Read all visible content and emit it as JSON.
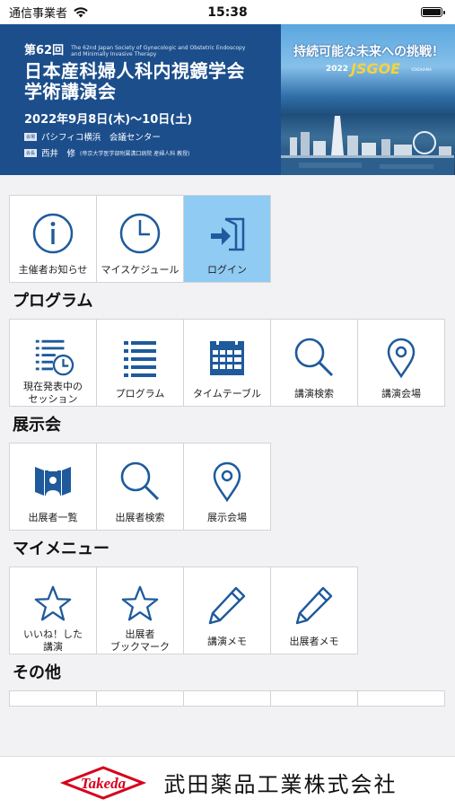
{
  "status_bar": {
    "carrier": "通信事業者",
    "time": "15:38"
  },
  "banner": {
    "edition": "第62回",
    "title_en_line1": "The 62nd Japan Society of Gynecologic and Obstetric Endoscopy",
    "title_en_line2": "and Minimally Invasive Therapy",
    "title_line1": "日本産科婦人科内視鏡学会",
    "title_line2": "学術講演会",
    "date": "2022年9月8日(木)〜10日(土)",
    "venue_tag": "会場",
    "venue": "パシフィコ横浜　会議センター",
    "chair_tag": "会長",
    "chair": "西井　修",
    "chair_affil": "(帝京大学医学部附属溝口病院 産婦人科 教授)",
    "slogan": "持続可能な未来への挑戦！",
    "logo_year": "2022",
    "logo_name": "JSGOE",
    "logo_city": "YOKOHAMA"
  },
  "top_tiles": [
    {
      "label": "主催者お知らせ",
      "icon": "info-icon"
    },
    {
      "label": "マイスケジュール",
      "icon": "clock-icon"
    },
    {
      "label": "ログイン",
      "icon": "login-icon"
    }
  ],
  "sections": {
    "program": {
      "title": "プログラム",
      "tiles": [
        {
          "label": "現在発表中の\nセッション",
          "icon": "current-session-icon"
        },
        {
          "label": "プログラム",
          "icon": "list-icon"
        },
        {
          "label": "タイムテーブル",
          "icon": "calendar-icon"
        },
        {
          "label": "講演検索",
          "icon": "search-icon"
        },
        {
          "label": "講演会場",
          "icon": "location-pin-icon"
        }
      ]
    },
    "exhibition": {
      "title": "展示会",
      "tiles": [
        {
          "label": "出展者一覧",
          "icon": "exhibitor-icon"
        },
        {
          "label": "出展者検索",
          "icon": "search-icon"
        },
        {
          "label": "展示会場",
          "icon": "location-pin-icon"
        }
      ]
    },
    "mymenu": {
      "title": "マイメニュー",
      "tiles": [
        {
          "label": "いいね！した\n講演",
          "icon": "star-icon"
        },
        {
          "label": "出展者\nブックマーク",
          "icon": "star-icon"
        },
        {
          "label": "講演メモ",
          "icon": "pencil-icon"
        },
        {
          "label": "出展者メモ",
          "icon": "pencil-icon"
        }
      ]
    },
    "other": {
      "title": "その他"
    }
  },
  "sponsor": {
    "logo_text": "Takeda",
    "name": "武田薬品工業株式会社"
  },
  "colors": {
    "icon_blue": "#1e5a9c",
    "active_tile": "#8fcbf3",
    "banner_blue": "#1c4e8c"
  }
}
